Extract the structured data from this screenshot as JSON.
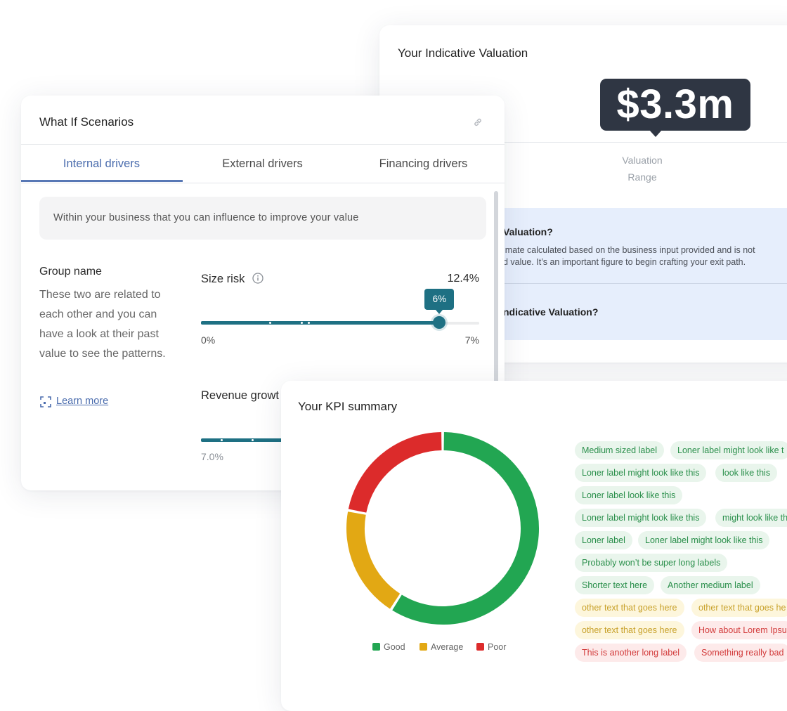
{
  "colors": {
    "accent_tab": "#4a6cad",
    "slider": "#1e7083",
    "good": "#22a652",
    "average": "#e2a814",
    "poor": "#dc2b2b",
    "bubble": "#2f3643"
  },
  "valuation": {
    "title": "Your Indicative Valuation",
    "amount": "$3.3m",
    "range_label_line1": "Valuation",
    "range_label_line2": "Range",
    "faq": {
      "q1": "Valuation?",
      "a1_line1": "imate calculated based on the business input provided and is not",
      "a1_line2": "d value. It’s an important figure to begin crafting your exit path.",
      "q2": "ndicative Valuation?"
    }
  },
  "whatif": {
    "title": "What If Scenarios",
    "link_icon": "link-icon",
    "tabs": [
      {
        "label": "Internal drivers",
        "active": true
      },
      {
        "label": "External drivers",
        "active": false
      },
      {
        "label": "Financing drivers",
        "active": false
      }
    ],
    "info_text": "Within your business that you can influence to improve your value",
    "group": {
      "name": "Group name",
      "desc": "These two are related to each other and you can have a look at their past value to see the patterns.",
      "learn_more": "Learn more"
    },
    "sliders": [
      {
        "label": "Size risk",
        "value_text": "12.4%",
        "tooltip": "6%",
        "min_label": "0%",
        "max_label": "7%",
        "min": 0,
        "max": 7,
        "value": 6
      },
      {
        "label": "Revenue growt",
        "min_label": "7.0%"
      }
    ]
  },
  "kpi": {
    "title": "Your KPI summary",
    "chart_data": {
      "type": "pie",
      "categories": [
        "Good",
        "Average",
        "Poor"
      ],
      "values": [
        59,
        19,
        22
      ],
      "legend": "bottom"
    },
    "legend": [
      "Good",
      "Average",
      "Poor"
    ],
    "chips": [
      {
        "text": "Medium sized label",
        "status": "good"
      },
      {
        "text": "Loner label might look like t",
        "status": "good"
      },
      {
        "text": "Loner label might look like this",
        "status": "good"
      },
      {
        "text": "look like this",
        "status": "good"
      },
      {
        "text": "Loner label  look like this",
        "status": "good"
      },
      {
        "text": "Loner label might look like this",
        "status": "good"
      },
      {
        "text": "might look like th",
        "status": "good"
      },
      {
        "text": "Loner label",
        "status": "good"
      },
      {
        "text": "Loner label might look like this",
        "status": "good"
      },
      {
        "text": "Probably won’t be super long labels",
        "status": "good"
      },
      {
        "text": "Shorter text here",
        "status": "good"
      },
      {
        "text": "Another medium label",
        "status": "good"
      },
      {
        "text": "other text that goes here",
        "status": "average"
      },
      {
        "text": "other text that goes he",
        "status": "average"
      },
      {
        "text": "other text that goes here",
        "status": "average"
      },
      {
        "text": "How about Lorem Ipsu",
        "status": "poor"
      },
      {
        "text": "This is another long label",
        "status": "poor"
      },
      {
        "text": "Something really bad",
        "status": "poor"
      }
    ]
  }
}
